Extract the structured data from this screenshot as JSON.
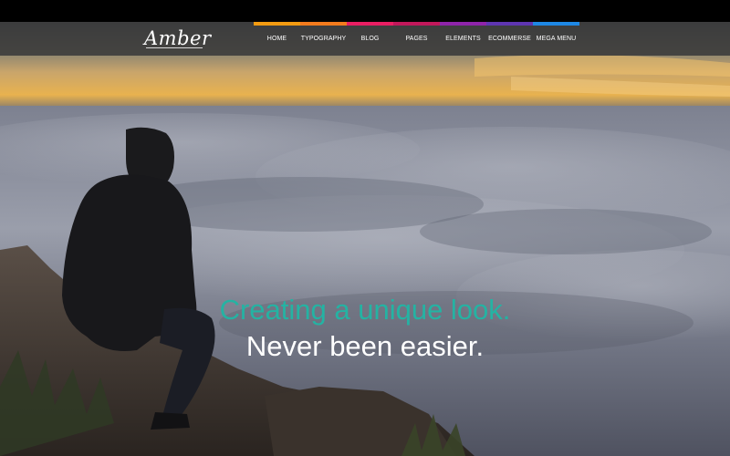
{
  "brand": {
    "logo_text": "Amber"
  },
  "nav": {
    "items": [
      {
        "label": "HOME",
        "color": "#f39c12"
      },
      {
        "label": "TYPOGRAPHY",
        "color": "#f37b1d"
      },
      {
        "label": "BLOG",
        "color": "#e91e63"
      },
      {
        "label": "PAGES",
        "color": "#c2185b"
      },
      {
        "label": "ELEMENTS",
        "color": "#8e24aa"
      },
      {
        "label": "ECOMMERSE",
        "color": "#5e35b1"
      },
      {
        "label": "MEGA MENU",
        "color": "#1e88e5"
      }
    ]
  },
  "hero": {
    "line1": "Creating a unique look.",
    "line2": "Never been easier.",
    "accent_color": "#24b3a3"
  }
}
